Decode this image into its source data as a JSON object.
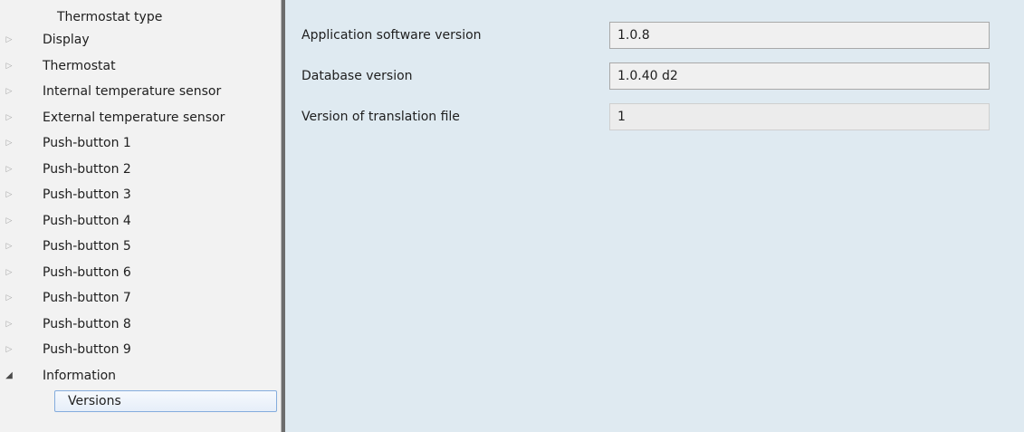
{
  "tree": {
    "items": [
      {
        "label": "Thermostat type",
        "expander": "",
        "level": 1
      },
      {
        "label": "Display",
        "expander": "collapsed",
        "level": 0
      },
      {
        "label": "Thermostat",
        "expander": "collapsed",
        "level": 0
      },
      {
        "label": "Internal temperature sensor",
        "expander": "collapsed",
        "level": 0
      },
      {
        "label": "External temperature sensor",
        "expander": "collapsed",
        "level": 0
      },
      {
        "label": "Push-button 1",
        "expander": "collapsed",
        "level": 0
      },
      {
        "label": "Push-button 2",
        "expander": "collapsed",
        "level": 0
      },
      {
        "label": "Push-button 3",
        "expander": "collapsed",
        "level": 0
      },
      {
        "label": "Push-button 4",
        "expander": "collapsed",
        "level": 0
      },
      {
        "label": "Push-button 5",
        "expander": "collapsed",
        "level": 0
      },
      {
        "label": "Push-button 6",
        "expander": "collapsed",
        "level": 0
      },
      {
        "label": "Push-button 7",
        "expander": "collapsed",
        "level": 0
      },
      {
        "label": "Push-button 8",
        "expander": "collapsed",
        "level": 0
      },
      {
        "label": "Push-button 9",
        "expander": "collapsed",
        "level": 0
      },
      {
        "label": "Information",
        "expander": "expanded",
        "level": 0
      },
      {
        "label": "Versions",
        "expander": "",
        "level": 1,
        "selected": true
      }
    ]
  },
  "params": [
    {
      "label": "Application software version",
      "value": "1.0.8"
    },
    {
      "label": "Database version",
      "value": "1.0.40 d2"
    },
    {
      "label": "Version of translation file",
      "value": "1"
    }
  ],
  "colors": {
    "tree_bg": "#f2f2f2",
    "content_bg": "#dfeaf1",
    "selection_border": "#84acdd"
  }
}
